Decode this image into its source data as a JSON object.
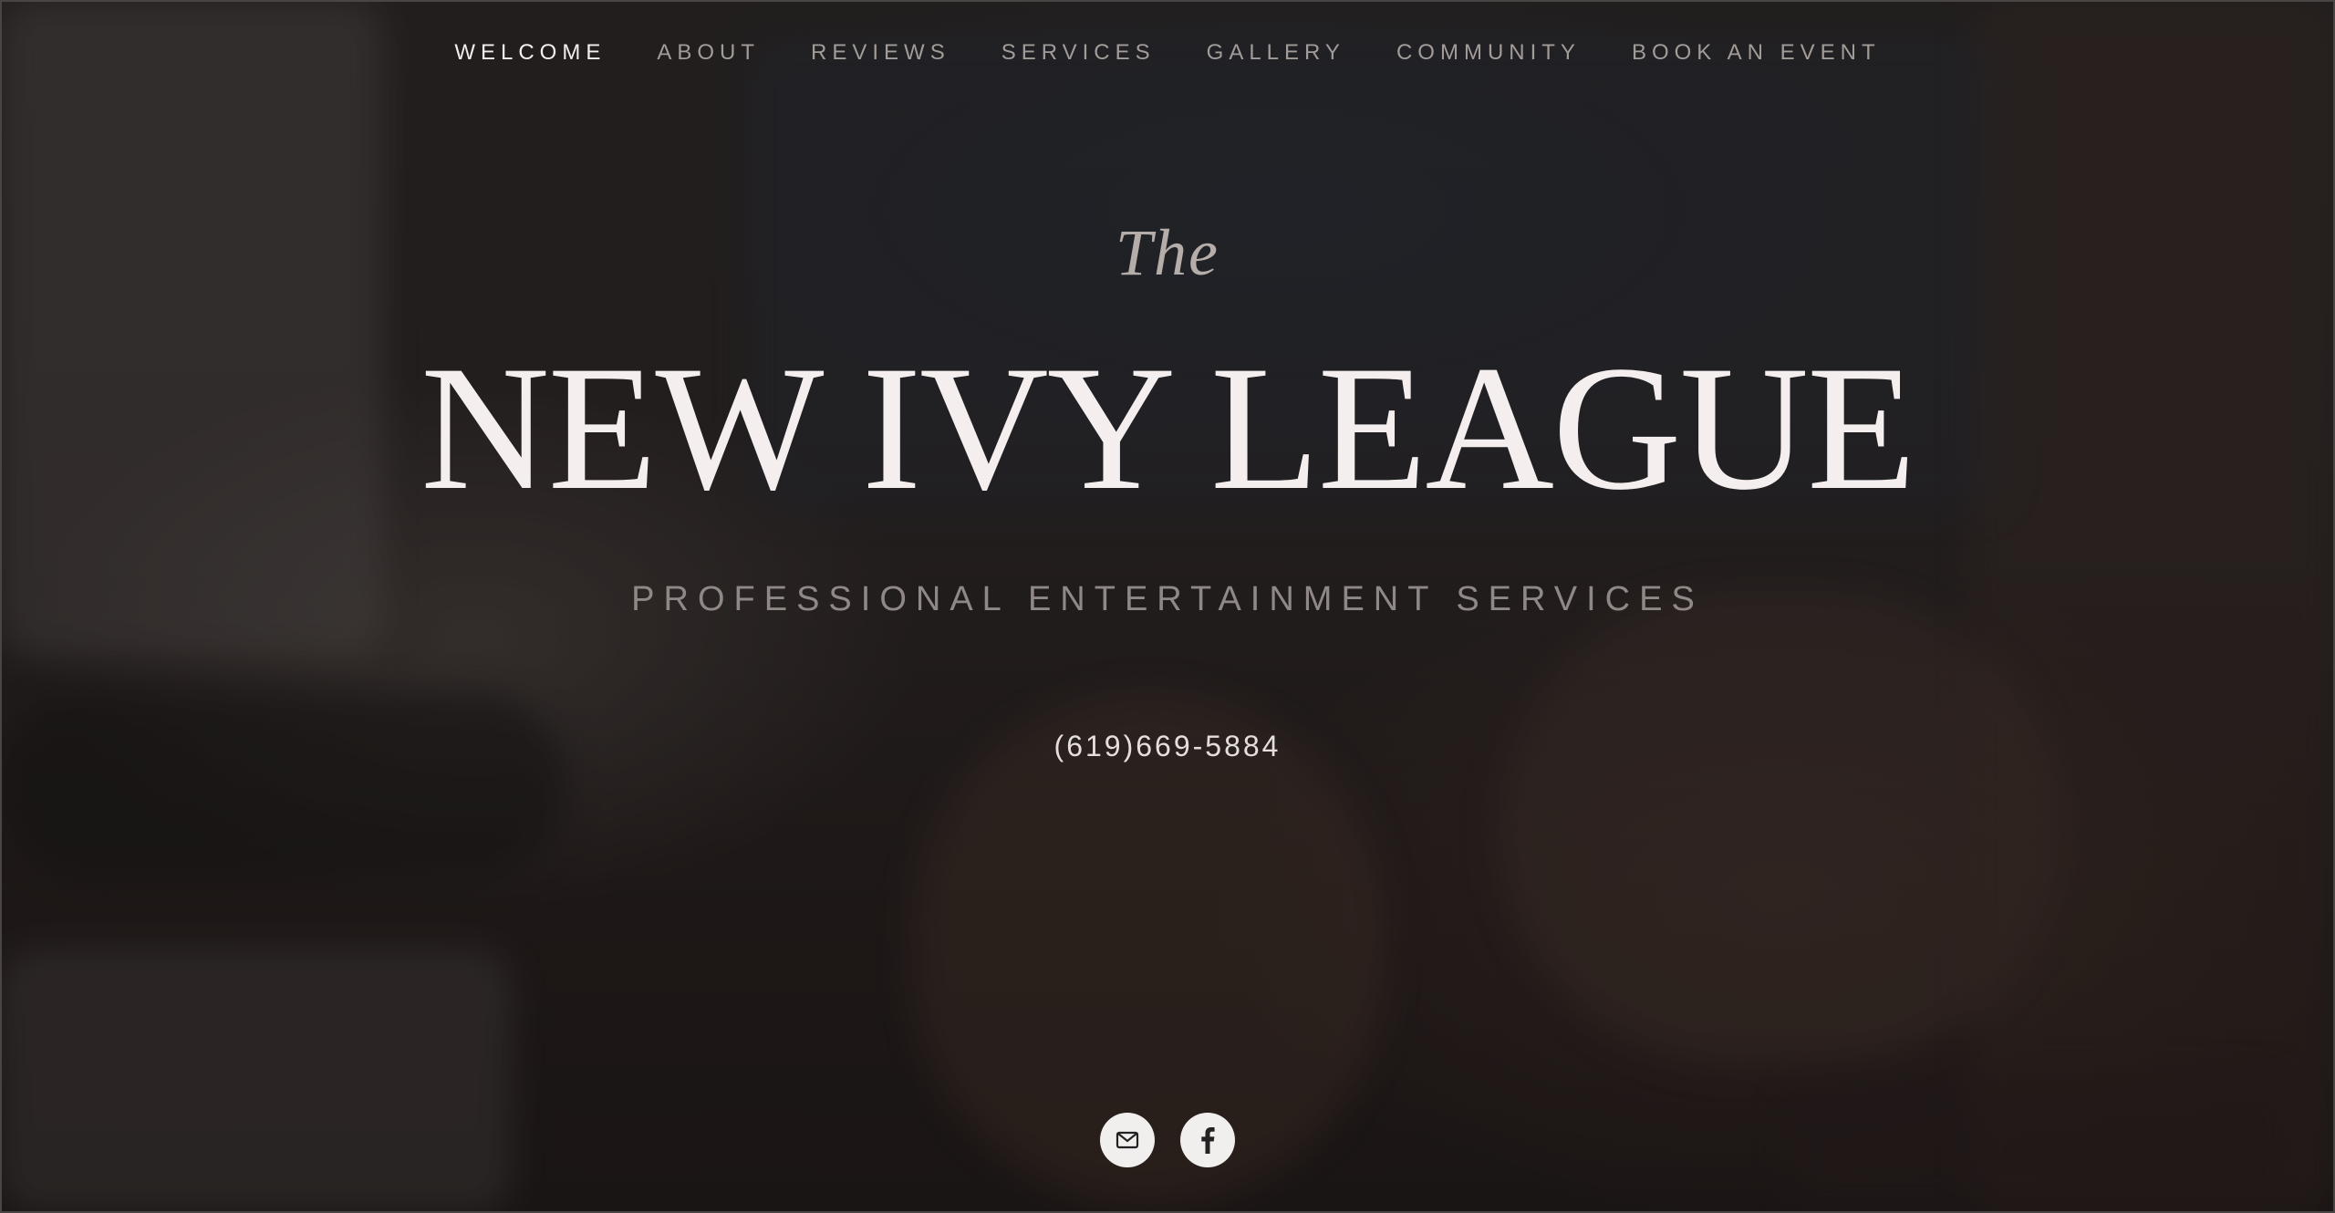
{
  "nav": {
    "items": [
      {
        "label": "WELCOME",
        "active": true
      },
      {
        "label": "ABOUT",
        "active": false
      },
      {
        "label": "REVIEWS",
        "active": false
      },
      {
        "label": "SERVICES",
        "active": false
      },
      {
        "label": "GALLERY",
        "active": false
      },
      {
        "label": "COMMUNITY",
        "active": false
      },
      {
        "label": "BOOK AN EVENT",
        "active": false
      }
    ]
  },
  "hero": {
    "pre_title": "The",
    "title": "NEW IVY LEAGUE",
    "subtitle": "PROFESSIONAL ENTERTAINMENT SERVICES",
    "phone": "(619)669-5884"
  },
  "social": {
    "icons": [
      "mail-icon",
      "facebook-icon"
    ]
  },
  "colors": {
    "background": "#2a2424",
    "title": "#f4eeee",
    "nav_inactive": "#a29c99",
    "nav_active": "#f3efef",
    "subtitle": "#8f8886",
    "icon_circle": "#f1eeee"
  }
}
